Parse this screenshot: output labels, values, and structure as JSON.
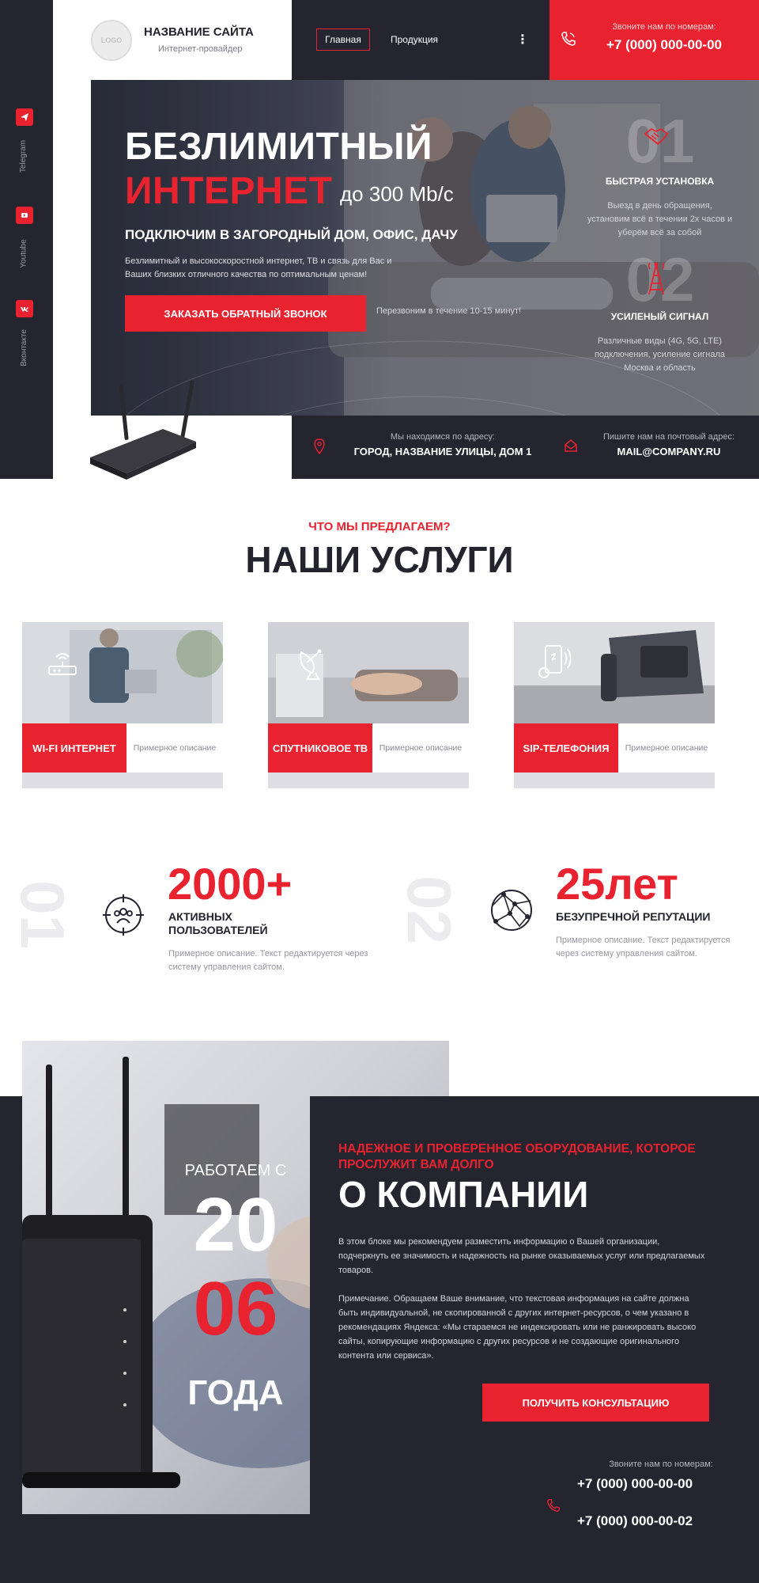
{
  "header": {
    "logo_text": "LOGO",
    "site_title": "НАЗВАНИЕ САЙТА",
    "site_subtitle": "Интернет-провайдер",
    "nav": {
      "home": "Главная",
      "products": "Продукция",
      "more": "⋮"
    },
    "phone_caption": "Звоните нам по номерам:",
    "phone_number": "+7 (000) 000-00-00",
    "accent": "#e8222f",
    "dark": "#252530"
  },
  "social": [
    {
      "label": "Telegram",
      "icon": "telegram-icon"
    },
    {
      "label": "Youtube",
      "icon": "youtube-icon"
    },
    {
      "label": "Вконтакте",
      "icon": "vk-icon"
    }
  ],
  "hero": {
    "title_line1": "БЕЗЛИМИТНЫЙ",
    "title_line2": "ИНТЕРНЕТ",
    "speed": "до 300 Mb/c",
    "subtitle": "ПОДКЛЮЧИМ В ЗАГОРОДНЫЙ ДОМ, ОФИС, ДАЧУ",
    "description": "Безлимитный и высокоскоростной интернет, ТВ и связь для Вас и Ваших близких отличного качества по оптимальным ценам!",
    "cta": "ЗАКАЗАТЬ ОБРАТНЫЙ ЗВОНОК",
    "cta_note": "Перезвоним в течение 10-15 минут!",
    "features": [
      {
        "num": "01",
        "title": "БЫСТРАЯ УСТАНОВКА",
        "desc": "Выезд в день обращения, установим всё в течении 2х часов и уберём всё за собой",
        "icon": "handshake-icon"
      },
      {
        "num": "02",
        "title": "УСИЛЕНЫЙ СИГНАЛ",
        "desc": "Различные виды (4G, 5G, LTE) подключения, усиление сигнала Москва и область",
        "icon": "antenna-tower-icon"
      }
    ]
  },
  "address_bar": {
    "address_caption": "Мы находимся по адресу:",
    "address_value": "ГОРОД, НАЗВАНИЕ УЛИЦЫ, ДОМ 1",
    "email_caption": "Пишите нам на почтовый адрес:",
    "email_value": "MAIL@COMPANY.RU"
  },
  "services": {
    "kicker": "ЧТО МЫ ПРЕДЛАГАЕМ?",
    "title": "НАШИ УСЛУГИ",
    "items": [
      {
        "title": "WI-FI ИНТЕРНЕТ",
        "desc": "Примерное описание",
        "icon": "wifi-router-icon"
      },
      {
        "title": "СПУТНИКОВОЕ ТВ",
        "desc": "Примерное описание",
        "icon": "satellite-dish-icon"
      },
      {
        "title": "SIP-ТЕЛЕФОНИЯ",
        "desc": "Примерное описание",
        "icon": "smartphone-signal-icon"
      }
    ]
  },
  "stats": [
    {
      "ghost": "01",
      "value": "2000+",
      "label": "АКТИВНЫХ ПОЛЬЗОВАТЕЛЕЙ",
      "desc": "Примерное описание. Текст редактируется через систему управления сайтом.",
      "icon": "users-target-icon"
    },
    {
      "ghost": "02",
      "value": "25лет",
      "label": "БЕЗУПРЕЧНОЙ РЕПУТАЦИИ",
      "desc": "Примерное описание. Текст редактируется через систему управления сайтом.",
      "icon": "globe-network-icon"
    }
  ],
  "about": {
    "work_since": "РАБОТАЕМ С",
    "year_part1": "20",
    "year_part2": "06",
    "years_word": "ГОДА",
    "kicker": "НАДЕЖНОЕ И ПРОВЕРЕННОЕ ОБОРУДОВАНИЕ, КОТОРОЕ ПРОСЛУЖИТ ВАМ ДОЛГО",
    "title": "О КОМПАНИИ",
    "paragraph1": "В этом блоке мы рекомендуем разместить информацию о Вашей организации, подчеркнуть ее значимость и надежность на рынке оказываемых услуг или предлагаемых товаров.",
    "paragraph2": "Примечание. Обращаем Ваше внимание, что текстовая информация на сайте должна быть индивидуальной, не скопированной с других интернет-ресурсов, о чем указано в рекомендациях Яндекса: «Мы стараемся не индексировать или не ранжировать высоко сайты, копирующие информацию с других ресурсов и не создающие оригинального контента или сервиса».",
    "cta": "ПОЛУЧИТЬ КОНСУЛЬТАЦИЮ",
    "phone_caption": "Звоните нам по номерам:",
    "phones": [
      "+7 (000) 000-00-00",
      "+7 (000) 000-00-02"
    ]
  }
}
